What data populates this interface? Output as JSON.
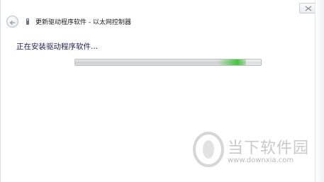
{
  "window": {
    "title": "更新驱动程序软件 - 以太网控制器",
    "heading": "正在安装驱动程序软件...",
    "progress_fraction": 0.92,
    "accent_color": "#41c83a"
  },
  "icons": {
    "close": "close-icon",
    "back": "back-arrow-icon",
    "device": "network-device-icon"
  },
  "watermark": {
    "name": "当下软件园",
    "url": "www.downxia.com"
  }
}
